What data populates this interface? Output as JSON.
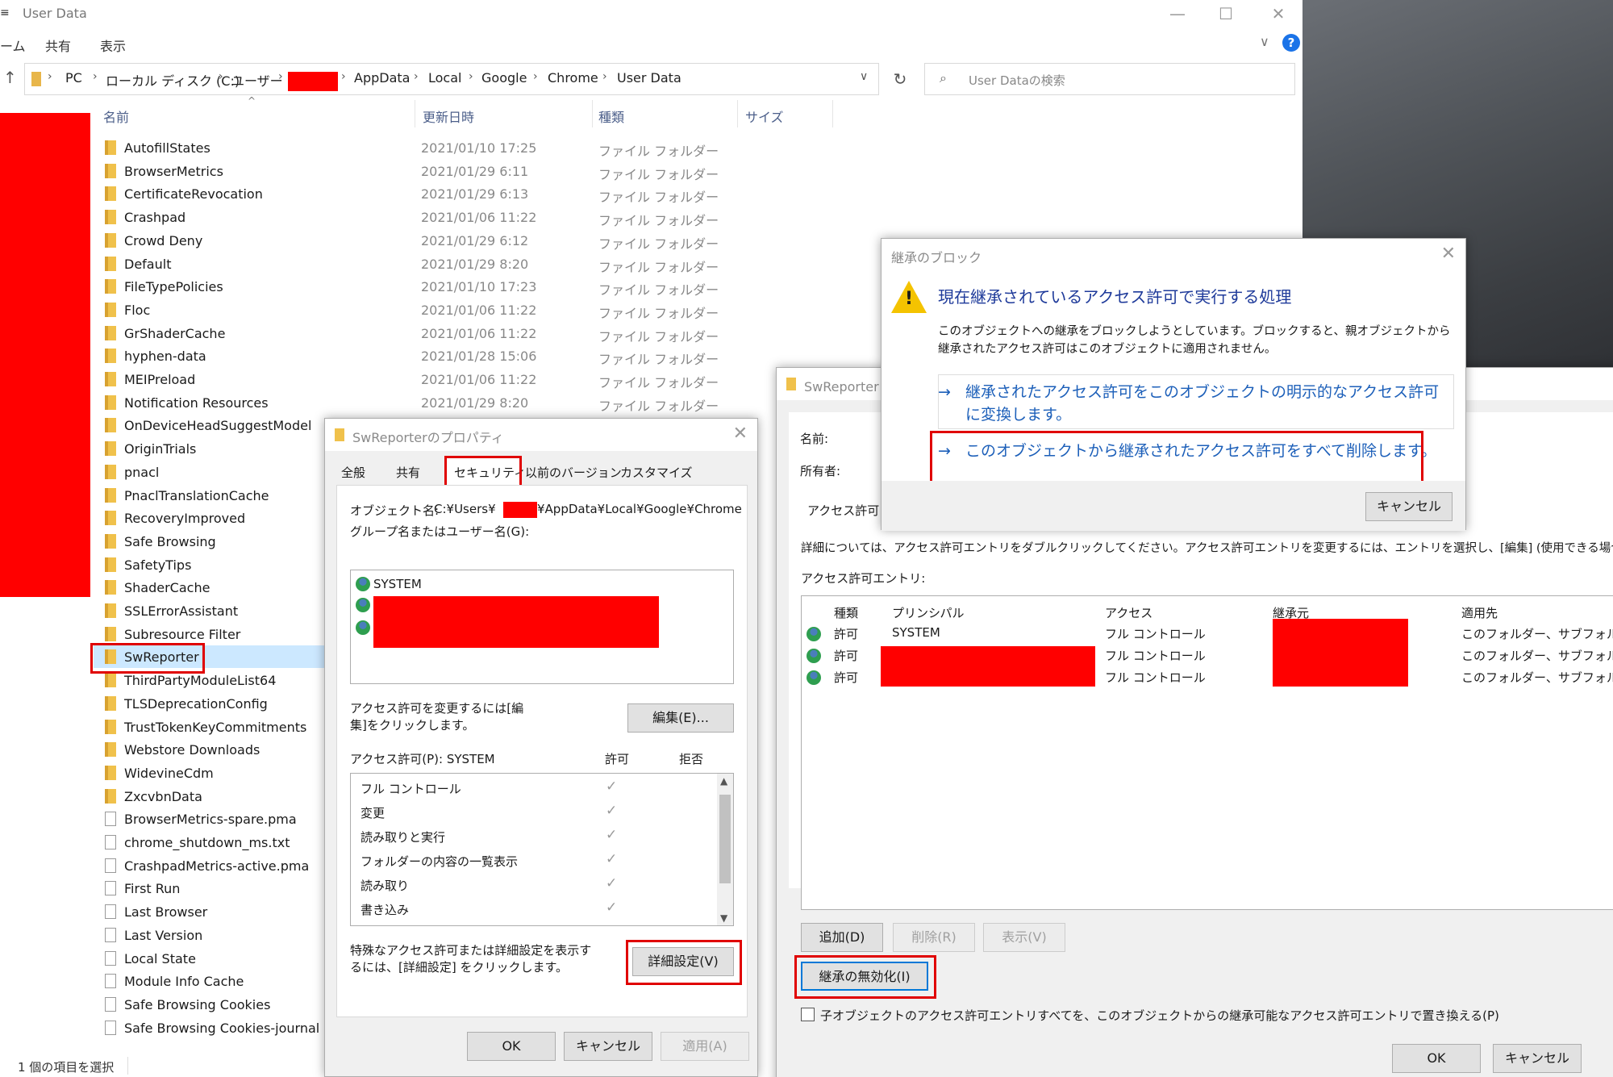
{
  "explorer": {
    "title": "User Data",
    "menu_glyph": "≡",
    "ribbon_tabs": [
      "ーム",
      "共有",
      "表示"
    ],
    "breadcrumb": [
      "PC",
      "ローカル ディスク (C:)",
      "ユーザー",
      "AppData",
      "Local",
      "Google",
      "Chrome",
      "User Data"
    ],
    "search_placeholder": "User Dataの検索",
    "columns": {
      "name": "名前",
      "date": "更新日時",
      "type": "種類",
      "size": "サイズ"
    },
    "files": [
      {
        "name": "AutofillStates",
        "date": "2021/01/10 17:25",
        "type": "ファイル フォルダー",
        "kind": "folder"
      },
      {
        "name": "BrowserMetrics",
        "date": "2021/01/29 6:11",
        "type": "ファイル フォルダー",
        "kind": "folder"
      },
      {
        "name": "CertificateRevocation",
        "date": "2021/01/29 6:13",
        "type": "ファイル フォルダー",
        "kind": "folder"
      },
      {
        "name": "Crashpad",
        "date": "2021/01/06 11:22",
        "type": "ファイル フォルダー",
        "kind": "folder"
      },
      {
        "name": "Crowd Deny",
        "date": "2021/01/29 6:12",
        "type": "ファイル フォルダー",
        "kind": "folder"
      },
      {
        "name": "Default",
        "date": "2021/01/29 8:20",
        "type": "ファイル フォルダー",
        "kind": "folder"
      },
      {
        "name": "FileTypePolicies",
        "date": "2021/01/10 17:23",
        "type": "ファイル フォルダー",
        "kind": "folder"
      },
      {
        "name": "Floc",
        "date": "2021/01/06 11:22",
        "type": "ファイル フォルダー",
        "kind": "folder"
      },
      {
        "name": "GrShaderCache",
        "date": "2021/01/06 11:22",
        "type": "ファイル フォルダー",
        "kind": "folder"
      },
      {
        "name": "hyphen-data",
        "date": "2021/01/28 15:06",
        "type": "ファイル フォルダー",
        "kind": "folder"
      },
      {
        "name": "MEIPreload",
        "date": "2021/01/06 11:22",
        "type": "ファイル フォルダー",
        "kind": "folder"
      },
      {
        "name": "Notification Resources",
        "date": "2021/01/29 8:20",
        "type": "ファイル フォルダー",
        "kind": "folder"
      },
      {
        "name": "OnDeviceHeadSuggestModel",
        "date": "",
        "type": "",
        "kind": "folder"
      },
      {
        "name": "OriginTrials",
        "date": "",
        "type": "",
        "kind": "folder"
      },
      {
        "name": "pnacl",
        "date": "",
        "type": "",
        "kind": "folder"
      },
      {
        "name": "PnaclTranslationCache",
        "date": "",
        "type": "",
        "kind": "folder"
      },
      {
        "name": "RecoveryImproved",
        "date": "",
        "type": "",
        "kind": "folder"
      },
      {
        "name": "Safe Browsing",
        "date": "",
        "type": "",
        "kind": "folder"
      },
      {
        "name": "SafetyTips",
        "date": "",
        "type": "",
        "kind": "folder"
      },
      {
        "name": "ShaderCache",
        "date": "",
        "type": "",
        "kind": "folder"
      },
      {
        "name": "SSLErrorAssistant",
        "date": "",
        "type": "",
        "kind": "folder"
      },
      {
        "name": "Subresource Filter",
        "date": "",
        "type": "",
        "kind": "folder"
      },
      {
        "name": "SwReporter",
        "date": "",
        "type": "",
        "kind": "folder",
        "selected": true
      },
      {
        "name": "ThirdPartyModuleList64",
        "date": "",
        "type": "",
        "kind": "folder"
      },
      {
        "name": "TLSDeprecationConfig",
        "date": "",
        "type": "",
        "kind": "folder"
      },
      {
        "name": "TrustTokenKeyCommitments",
        "date": "",
        "type": "",
        "kind": "folder"
      },
      {
        "name": "Webstore Downloads",
        "date": "",
        "type": "",
        "kind": "folder"
      },
      {
        "name": "WidevineCdm",
        "date": "",
        "type": "",
        "kind": "folder"
      },
      {
        "name": "ZxcvbnData",
        "date": "",
        "type": "",
        "kind": "folder"
      },
      {
        "name": "BrowserMetrics-spare.pma",
        "date": "",
        "type": "",
        "kind": "file"
      },
      {
        "name": "chrome_shutdown_ms.txt",
        "date": "",
        "type": "",
        "kind": "file"
      },
      {
        "name": "CrashpadMetrics-active.pma",
        "date": "",
        "type": "",
        "kind": "file"
      },
      {
        "name": "First Run",
        "date": "",
        "type": "",
        "kind": "file"
      },
      {
        "name": "Last Browser",
        "date": "",
        "type": "",
        "kind": "file"
      },
      {
        "name": "Last Version",
        "date": "",
        "type": "",
        "kind": "file"
      },
      {
        "name": "Local State",
        "date": "",
        "type": "",
        "kind": "file"
      },
      {
        "name": "Module Info Cache",
        "date": "",
        "type": "",
        "kind": "file"
      },
      {
        "name": "Safe Browsing Cookies",
        "date": "",
        "type": "",
        "kind": "file"
      },
      {
        "name": "Safe Browsing Cookies-journal",
        "date": "",
        "type": "",
        "kind": "file"
      }
    ],
    "status": "1 個の項目を選択"
  },
  "properties": {
    "title": "SwReporterのプロパティ",
    "tabs": [
      "全般",
      "共有",
      "セキュリティ",
      "以前のバージョン",
      "カスタマイズ"
    ],
    "object_label": "オブジェクト名:",
    "object_path_prefix": "C:¥Users¥",
    "object_path_suffix": "¥AppData¥Local¥Google¥Chrome",
    "groups_label": "グループ名またはユーザー名(G):",
    "system_user": "SYSTEM",
    "edit_hint": "アクセス許可を変更するには[編集]をクリックします。",
    "edit_button": "編集(E)...",
    "perm_label": "アクセス許可(P): SYSTEM",
    "allow_header": "許可",
    "deny_header": "拒否",
    "permissions": [
      "フル コントロール",
      "変更",
      "読み取りと実行",
      "フォルダーの内容の一覧表示",
      "読み取り",
      "書き込み"
    ],
    "check_glyph": "✓",
    "advanced_hint": "特殊なアクセス許可または詳細設定を表示するには、[詳細設定] をクリックします。",
    "advanced_button": "詳細設定(V)",
    "ok": "OK",
    "cancel": "キャンセル",
    "apply": "適用(A)"
  },
  "advanced": {
    "title": "SwReporter の",
    "name_label": "名前:",
    "owner_label": "所有者:",
    "permissions_tab": "アクセス許可",
    "info": "詳細については、アクセス許可エントリをダブルクリックしてください。アクセス許可エントリを変更するには、エントリを選択し、[編集] (使用できる場合) をクリック",
    "entries_label": "アクセス許可エントリ:",
    "headers": [
      "種類",
      "プリンシパル",
      "アクセス",
      "継承元",
      "適用先"
    ],
    "entries": [
      {
        "type": "許可",
        "principal": "SYSTEM",
        "access": "フル コントロール",
        "applies": "このフォルダー、サブフォルダーお"
      },
      {
        "type": "許可",
        "principal": "",
        "access": "フル コントロール",
        "applies": "このフォルダー、サブフォルダーお"
      },
      {
        "type": "許可",
        "principal": "",
        "access": "フル コントロール",
        "applies": "このフォルダー、サブフォルダーお"
      }
    ],
    "add_button": "追加(D)",
    "remove_button": "削除(R)",
    "view_button": "表示(V)",
    "disable_inheritance": "継承の無効化(I)",
    "replace_checkbox": "子オブジェクトのアクセス許可エントリすべてを、このオブジェクトからの継承可能なアクセス許可エントリで置き換える(P)",
    "ok": "OK",
    "cancel": "キャンセル"
  },
  "block": {
    "title": "継承のブロック",
    "heading": "現在継承されているアクセス許可で実行する処理",
    "description": "このオブジェクトへの継承をブロックしようとしています。ブロックすると、親オブジェクトから継承されたアクセス許可はこのオブジェクトに適用されません。",
    "option_convert": "継承されたアクセス許可をこのオブジェクトの明示的なアクセス許可に変換します。",
    "option_remove": "このオブジェクトから継承されたアクセス許可をすべて削除します。",
    "arrow": "→",
    "cancel": "キャンセル"
  },
  "colors": {
    "redaction": "#ff0000",
    "highlight": "#e00000",
    "link": "#1c5fb9",
    "heading": "#1e3a9a"
  }
}
